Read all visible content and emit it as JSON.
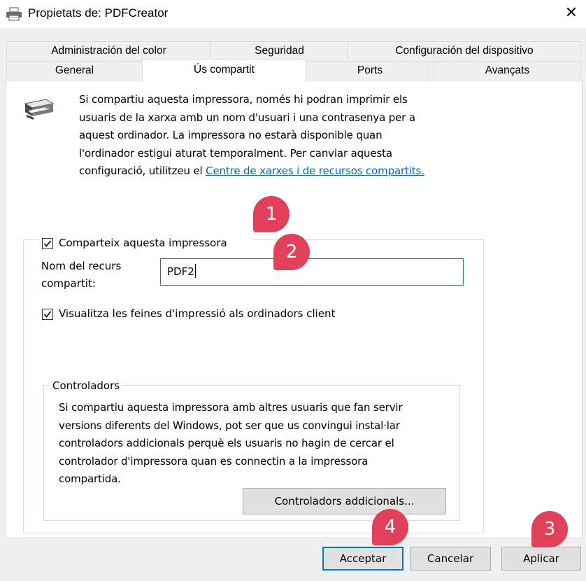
{
  "window": {
    "title": "Propietats de: PDFCreator",
    "close_glyph": "✕"
  },
  "tabs": {
    "row1": [
      "Administración del color",
      "Seguridad",
      "Configuración del dispositivo"
    ],
    "row2": [
      "General",
      "Ús compartit",
      "Ports",
      "Avançats"
    ],
    "active": "Ús compartit"
  },
  "info": {
    "lines": [
      "Si compartiu aquesta impressora, només hi podran imprimir els",
      "usuaris de la xarxa amb un nom d'usuari i una contrasenya per a",
      "aquest ordinador. La impressora no estarà disponible quan",
      "l'ordinador estigui aturat temporalment. Per canviar aquesta"
    ],
    "last_line_prefix": "configuració, utilitzeu el ",
    "link_text": "Centre de xarxes i de recursos compartits."
  },
  "share": {
    "checkbox_label": "Comparteix aquesta impressora",
    "checked": true,
    "share_name_label_line1": "Nom del recurs",
    "share_name_label_line2": "compartit:",
    "share_name_value": "PDF2",
    "render_jobs_label": "Visualitza les feines d'impressió als ordinadors client",
    "render_jobs_checked": true
  },
  "drivers": {
    "group_title": "Controladors",
    "lines": [
      "Si compartiu aquesta impressora amb altres usuaris que fan servir",
      "versions diferents del Windows, pot ser que us convingui instal·lar",
      "controladors addicionals perquè els usuaris no hagin de cercar el",
      "controlador d'impressora quan es connectin a la impressora",
      "compartida."
    ],
    "additional_button": "Controladors addicionals..."
  },
  "buttons": {
    "ok": "Acceptar",
    "cancel": "Cancelar",
    "apply": "Aplicar"
  },
  "badges": [
    "1",
    "2",
    "3",
    "4"
  ],
  "colors": {
    "accent": "#0078d7",
    "badge": "#e0405a",
    "link": "#0066cc"
  }
}
